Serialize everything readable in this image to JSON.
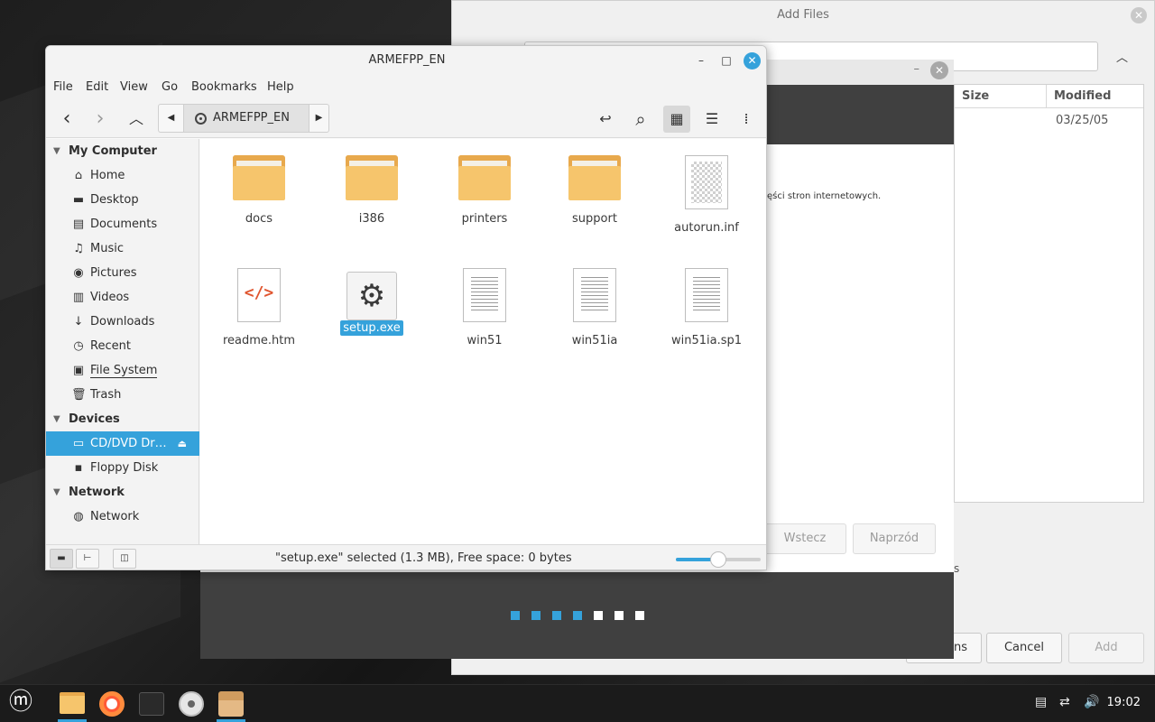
{
  "add_files": {
    "title": "Add Files",
    "close_icon": "✕",
    "up_icon": "︿",
    "columns": {
      "size": "Size",
      "modified": "Modified"
    },
    "row_modified": "03/25/05",
    "partial_button": "ns",
    "partial_text": "s",
    "cancel_label": "Cancel",
    "add_label": "Add"
  },
  "installer": {
    "close_icon": "✕",
    "minimize_icon": "–",
    "partial_text": "ęści stron internetowych.",
    "back_label": "Wstecz",
    "next_label": "Naprzód",
    "progress": {
      "filled": 4,
      "total": 7,
      "filled_color": "#35a2db",
      "empty_color": "#ffffff"
    }
  },
  "file_manager": {
    "title": "ARMEFPP_EN",
    "window_controls": {
      "minimize": "–",
      "maximize": "□",
      "close": "✕"
    },
    "menu": [
      "File",
      "Edit",
      "View",
      "Go",
      "Bookmarks",
      "Help"
    ],
    "toolbar": {
      "back_icon": "‹",
      "forward_icon": "›",
      "up_icon": "︿",
      "crumb_left": "◀",
      "crumb_right": "▶",
      "breadcrumb": "ARMEFPP_EN",
      "toggle_location_icon": "↩",
      "search_icon": "⌕",
      "grid_icon": "▦",
      "list_icon": "☰",
      "compact_icon": "⁞"
    },
    "sidebar": {
      "sections": [
        {
          "title": "My Computer",
          "arrow": "▼"
        },
        {
          "title": "Devices",
          "arrow": "▼"
        },
        {
          "title": "Network",
          "arrow": "▼"
        }
      ],
      "my_computer": [
        {
          "label": "Home",
          "icon": "⌂"
        },
        {
          "label": "Desktop",
          "icon": "▬"
        },
        {
          "label": "Documents",
          "icon": "▤"
        },
        {
          "label": "Music",
          "icon": "♫"
        },
        {
          "label": "Pictures",
          "icon": "◉"
        },
        {
          "label": "Videos",
          "icon": "▥"
        },
        {
          "label": "Downloads",
          "icon": "↓"
        },
        {
          "label": "Recent",
          "icon": "◷"
        },
        {
          "label": "File System",
          "icon": "▣"
        },
        {
          "label": "Trash",
          "icon": "🗑"
        }
      ],
      "devices": [
        {
          "label": "CD/DVD Dr…",
          "icon": "▭",
          "eject": "⏏"
        },
        {
          "label": "Floppy Disk",
          "icon": "▪"
        }
      ],
      "network": [
        {
          "label": "Network",
          "icon": "◍"
        }
      ]
    },
    "files": [
      {
        "name": "docs",
        "type": "folder"
      },
      {
        "name": "i386",
        "type": "folder"
      },
      {
        "name": "printers",
        "type": "folder"
      },
      {
        "name": "support",
        "type": "folder"
      },
      {
        "name": "autorun.inf",
        "type": "blank"
      },
      {
        "name": "readme.htm",
        "type": "html",
        "glyph": "</>"
      },
      {
        "name": "setup.exe",
        "type": "exe",
        "glyph": "⚙"
      },
      {
        "name": "win51",
        "type": "text"
      },
      {
        "name": "win51ia",
        "type": "text"
      },
      {
        "name": "win51ia.sp1",
        "type": "text"
      }
    ],
    "selected_file": "setup.exe",
    "status": "\"setup.exe\" selected (1.3 MB), Free space: 0 bytes",
    "status_buttons": {
      "places": "▬",
      "tree": "⊢",
      "hide_sidebar": "◫"
    },
    "zoom_fraction": 0.5
  },
  "taskbar": {
    "menu_icon": "ⓜ",
    "time": "19:02",
    "tray": {
      "notes": "▤",
      "network": "⇄",
      "volume": "🔊"
    }
  }
}
